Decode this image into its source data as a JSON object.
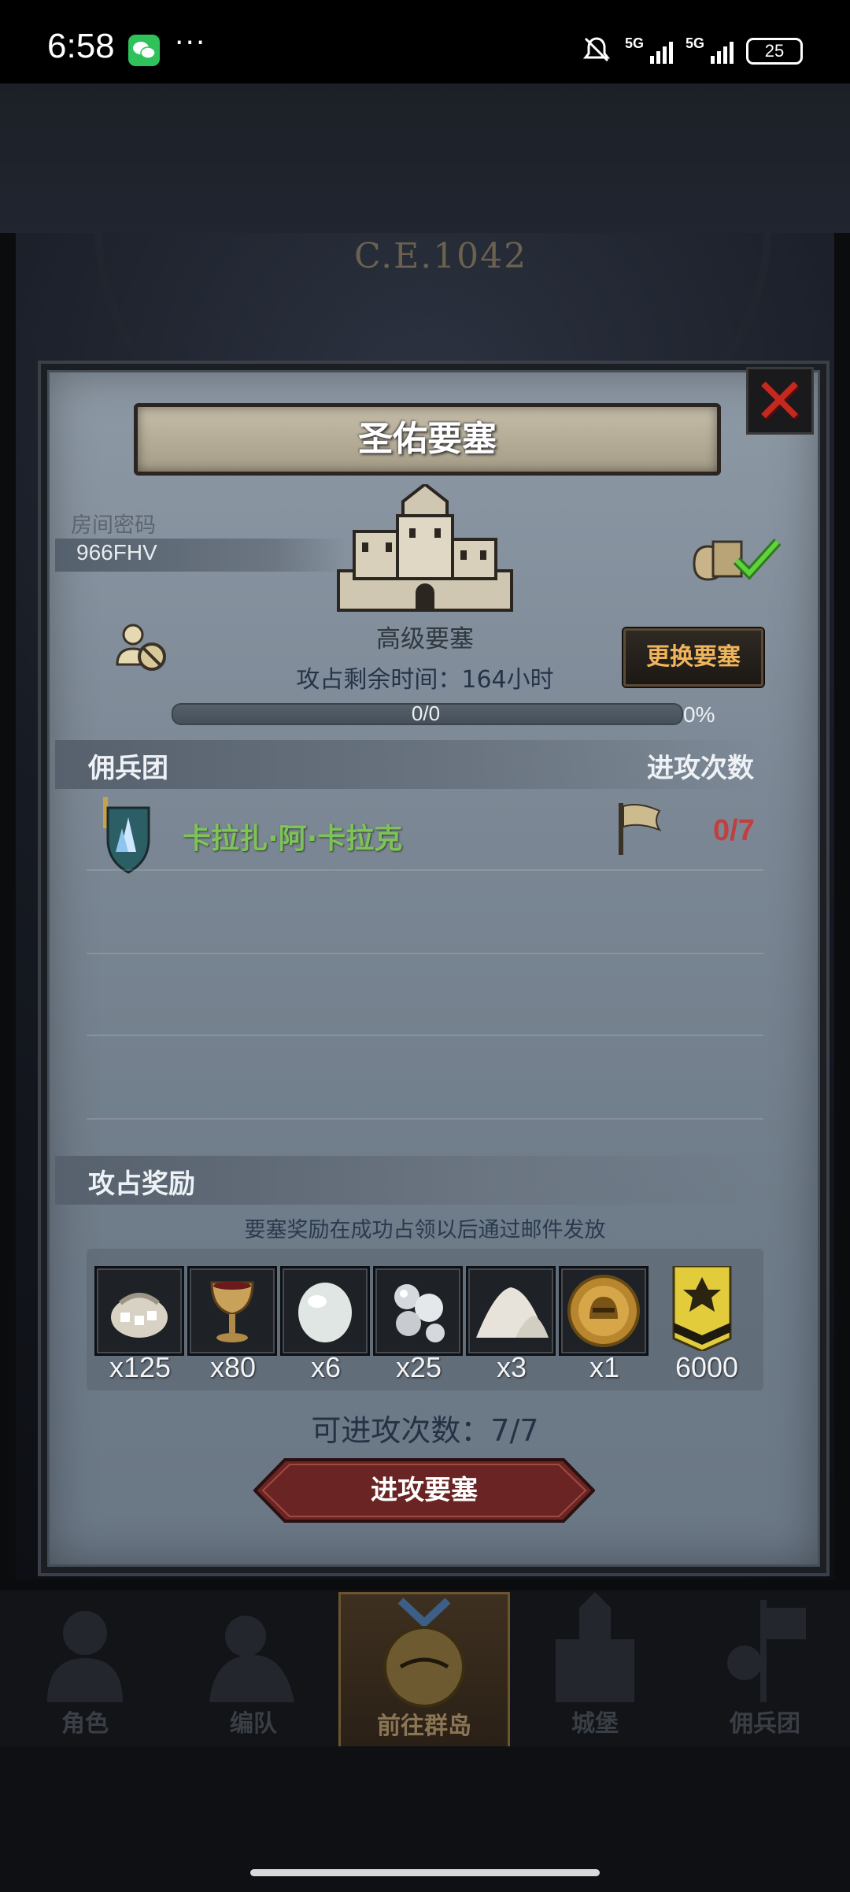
{
  "status_bar": {
    "time": "6:58",
    "dots": "···",
    "net1": "5G",
    "net2": "5G",
    "battery": "25"
  },
  "scene": {
    "era": "C.E.1042"
  },
  "dialog": {
    "title": "圣佑要塞",
    "room_label": "房间密码",
    "room_code": "966FHV",
    "fortress_type": "高级要塞",
    "change_button": "更换要塞",
    "time_left": "攻占剩余时间：164小时",
    "progress": {
      "text": "0/0",
      "percent_label": "0%",
      "fraction": 0
    },
    "mercenary_header": "佣兵团",
    "attacks_header": "进攻次数",
    "guild": {
      "name": "卡拉扎·阿·卡拉克",
      "attacks": "0/7"
    },
    "reward_header": "攻占奖励",
    "reward_note": "要塞奖励在成功占领以后通过邮件发放",
    "rewards": [
      {
        "icon": "ore-sack-icon",
        "qty": "x125"
      },
      {
        "icon": "goblet-icon",
        "qty": "x80"
      },
      {
        "icon": "white-stone-icon",
        "qty": "x6"
      },
      {
        "icon": "silver-pearls-icon",
        "qty": "x25"
      },
      {
        "icon": "salt-pile-icon",
        "qty": "x3"
      },
      {
        "icon": "knight-medal-icon",
        "qty": "x1"
      },
      {
        "icon": "guild-banner-icon",
        "qty": "6000"
      }
    ],
    "attacks_available": "可进攻次数：7/7",
    "attack_button": "进攻要塞"
  },
  "bottom_nav": [
    {
      "label": "角色",
      "icon": "character-icon"
    },
    {
      "label": "编队",
      "icon": "formation-icon"
    },
    {
      "label": "前往群岛",
      "icon": "islands-icon",
      "active": true
    },
    {
      "label": "城堡",
      "icon": "castle-icon"
    },
    {
      "label": "佣兵团",
      "icon": "mercenary-icon"
    }
  ],
  "colors": {
    "guild_name": "#7ec25a",
    "attack_count": "#c04040",
    "change_button_text": "#f0b45a",
    "close_x": "#c4281f"
  }
}
